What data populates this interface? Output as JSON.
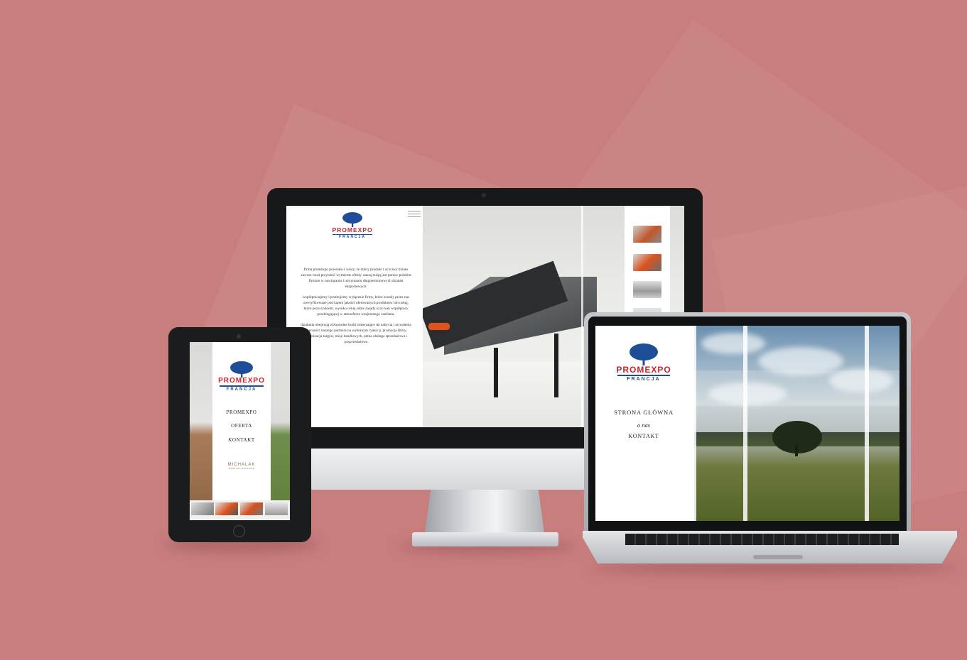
{
  "brand": {
    "name": "PROMEXPO",
    "sub": "FRANCJA"
  },
  "desktop": {
    "paragraphs": [
      "firma promexpo powstała z wiary, że dobry produkt i uczciwy biznes zawsze musi przynieść wymierne efekty. naszą misją jest pomoc polskim firmom w nawiązaniu i utrzymaniu długoterminowych działań eksportowych.",
      "współpracujemy i promujemy wyłącznie firmy, które zostały przez nas zweryfikowane pod kątem jakości oferowanych produktów lub usług, które poza zyskiem, wysoko cenią sobie zasady uczciwej współpracy przebiegającej w atmosferze wzajemnego zaufania.",
      "działania obejmują różnorodne kroki zmierzające do nabycia i utrwalenia obecności naszego partnera na wybranym rynku tj. promocja firmy, organizacja targów, misji handlowych, pełna obsługa sprzedażowa i posprzedażowa"
    ]
  },
  "tablet": {
    "nav": [
      "PROMEXPO",
      "OFERTA",
      "KONTAKT"
    ],
    "partner": {
      "name": "MICHALAK",
      "tagline": "MASZYNY ROLNICZE"
    }
  },
  "laptop": {
    "nav": [
      "STRONA GŁÓWNA",
      "o nas",
      "KONTAKT"
    ]
  },
  "colors": {
    "background": "#c97e7e",
    "brand_red": "#c9252c",
    "brand_blue": "#1f4e99"
  },
  "icons": [
    "tree-logo-icon",
    "hamburger-menu-icon"
  ]
}
